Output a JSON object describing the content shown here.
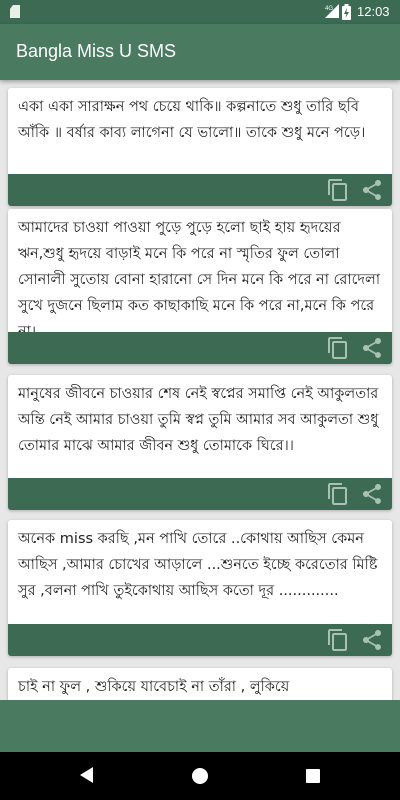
{
  "status_bar": {
    "time": "12:03",
    "network": "4G",
    "icons": [
      "sd-card-icon",
      "signal-icon",
      "battery-icon"
    ]
  },
  "app_bar": {
    "title": "Bangla Miss U SMS"
  },
  "colors": {
    "primary": "#4a7a60",
    "primary_dark": "#3c6a53",
    "background": "#e7e7e7",
    "card": "#ffffff"
  },
  "cards": [
    {
      "text": "একা একা সারাক্ষন পথ চেয়ে থাকি॥ কল্পনাতে শুধু তারি ছবি আঁকি ॥ বর্ষার কাব্য লাগেনা যে ভালো॥ তাকে শুধু মনে পড়ে।",
      "copy_icon": "copy-icon",
      "share_icon": "share-icon"
    },
    {
      "text": "আমাদের চাওয়া পাওয়া পুড়ে পুড়ে হলো ছাই হায় হৃদয়ের ঋন,শুধু হৃদয়ে বাড়াই মনে কি পরে না স্মৃতির ফুল তোলা সোনালী সুতোয় বোনা হারানো সে দিন মনে কি পরে না রোদেলা সুখে দুজনে ছিলাম কত কাছাকাছি মনে কি পরে না,মনে কি পরে না।",
      "copy_icon": "copy-icon",
      "share_icon": "share-icon"
    },
    {
      "text": "মানুষের জীবনে চাওয়ার শেষ নেই স্বপ্নের সমাপ্তি নেই আকুলতার অন্তি নেই আমার চাওয়া তুমি স্বপ্ন তুমি আমার সব আকুলতা শুধু তোমার মাঝে আমার জীবন শুধু তোমাকে ঘিরে।।",
      "copy_icon": "copy-icon",
      "share_icon": "share-icon"
    },
    {
      "text": "অনেক miss করছি ,মন পাখি তোরে ..কোথায় আছিস কেমন আছিস ,আমার চোখের আড়ালে ...শুনতে ইচ্ছে করেতোর মিষ্টি সুর ,বলনা পাখি তুইকোথায় আছিস কতো দূর .............",
      "copy_icon": "copy-icon",
      "share_icon": "share-icon"
    },
    {
      "text": "চাই না ফুল , শুকিয়ে যাবেচাই না তাঁরা , লুকিয়ে",
      "copy_icon": "copy-icon",
      "share_icon": "share-icon"
    }
  ],
  "nav_bar": {
    "icons": [
      "back-icon",
      "home-icon",
      "recents-icon"
    ]
  }
}
